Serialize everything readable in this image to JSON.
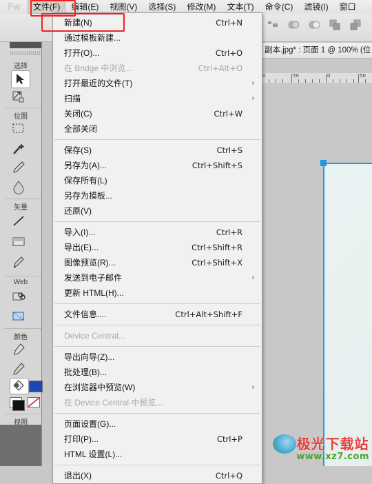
{
  "app": {
    "logo_text": "Fw",
    "document_tab": "副本.jpg* : 页面 1 @ 100% (位"
  },
  "menubar": {
    "items": [
      {
        "label": "文件(F)",
        "active": true
      },
      {
        "label": "编辑(E)",
        "active": false
      },
      {
        "label": "视图(V)",
        "active": false
      },
      {
        "label": "选择(S)",
        "active": false
      },
      {
        "label": "修改(M)",
        "active": false
      },
      {
        "label": "文本(T)",
        "active": false
      },
      {
        "label": "命令(C)",
        "active": false
      },
      {
        "label": "滤镜(I)",
        "active": false
      },
      {
        "label": "窗口",
        "active": false
      }
    ]
  },
  "file_menu": {
    "groups": [
      [
        {
          "label": "新建(N)",
          "accel": "Ctrl+N",
          "disabled": false,
          "submenu": false,
          "highlighted": true
        },
        {
          "label": "通过模板新建...",
          "accel": "",
          "disabled": false,
          "submenu": false
        },
        {
          "label": "打开(O)...",
          "accel": "Ctrl+O",
          "disabled": false,
          "submenu": false
        },
        {
          "label": "在 Bridge 中浏览...",
          "accel": "Ctrl+Alt+O",
          "disabled": true,
          "submenu": false
        },
        {
          "label": "打开最近的文件(T)",
          "accel": "",
          "disabled": false,
          "submenu": true
        },
        {
          "label": "扫描",
          "accel": "",
          "disabled": false,
          "submenu": true
        },
        {
          "label": "关闭(C)",
          "accel": "Ctrl+W",
          "disabled": false,
          "submenu": false
        },
        {
          "label": "全部关闭",
          "accel": "",
          "disabled": false,
          "submenu": false
        }
      ],
      [
        {
          "label": "保存(S)",
          "accel": "Ctrl+S",
          "disabled": false,
          "submenu": false
        },
        {
          "label": "另存为(A)...",
          "accel": "Ctrl+Shift+S",
          "disabled": false,
          "submenu": false
        },
        {
          "label": "保存所有(L)",
          "accel": "",
          "disabled": false,
          "submenu": false
        },
        {
          "label": "另存为摸板...",
          "accel": "",
          "disabled": false,
          "submenu": false
        },
        {
          "label": "还原(V)",
          "accel": "",
          "disabled": false,
          "submenu": false
        }
      ],
      [
        {
          "label": "导入(I)...",
          "accel": "Ctrl+R",
          "disabled": false,
          "submenu": false
        },
        {
          "label": "导出(E)...",
          "accel": "Ctrl+Shift+R",
          "disabled": false,
          "submenu": false
        },
        {
          "label": "图像预览(R)...",
          "accel": "Ctrl+Shift+X",
          "disabled": false,
          "submenu": false
        },
        {
          "label": "发送到电子邮件",
          "accel": "",
          "disabled": false,
          "submenu": true
        },
        {
          "label": "更新 HTML(H)...",
          "accel": "",
          "disabled": false,
          "submenu": false
        }
      ],
      [
        {
          "label": "文件信息....",
          "accel": "Ctrl+Alt+Shift+F",
          "disabled": false,
          "submenu": false
        }
      ],
      [
        {
          "label": "Device Central...",
          "accel": "",
          "disabled": true,
          "submenu": false
        }
      ],
      [
        {
          "label": "导出向导(Z)...",
          "accel": "",
          "disabled": false,
          "submenu": false
        },
        {
          "label": "批处理(B)...",
          "accel": "",
          "disabled": false,
          "submenu": false
        },
        {
          "label": "在浏览器中预览(W)",
          "accel": "",
          "disabled": false,
          "submenu": true
        },
        {
          "label": "在 Device Central 中预览...",
          "accel": "",
          "disabled": true,
          "submenu": false
        }
      ],
      [
        {
          "label": "页面设置(G)...",
          "accel": "",
          "disabled": false,
          "submenu": false
        },
        {
          "label": "打印(P)...",
          "accel": "Ctrl+P",
          "disabled": false,
          "submenu": false
        },
        {
          "label": "HTML 设置(L)...",
          "accel": "",
          "disabled": false,
          "submenu": false
        }
      ],
      [
        {
          "label": "退出(X)",
          "accel": "Ctrl+Q",
          "disabled": false,
          "submenu": false
        }
      ]
    ]
  },
  "toolbox": {
    "sections": [
      {
        "label": "选择"
      },
      {
        "label": "位图"
      },
      {
        "label": "矢量"
      },
      {
        "label": "Web"
      },
      {
        "label": "颜色"
      },
      {
        "label": "视图"
      }
    ],
    "fill_color": "#1b46b4",
    "stroke_color": "#ffffff"
  },
  "ruler": {
    "ticks": [
      "0",
      "50",
      "0",
      "50"
    ]
  },
  "annotations": {
    "highlight_color": "#ee2222"
  },
  "watermark": {
    "title": "极光下载站",
    "url": "www.xz7.com"
  }
}
